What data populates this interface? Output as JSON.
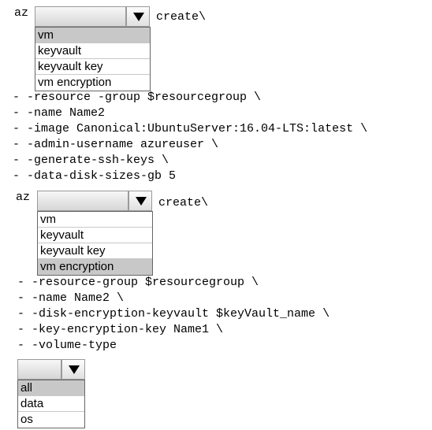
{
  "block1": {
    "prefix": "az",
    "suffix": "create\\",
    "options": [
      "vm",
      "keyvault",
      "keyvault key",
      "vm encryption"
    ],
    "selected_index": 0,
    "params": [
      "- -resource -group $resourcegroup \\",
      "- -name Name2",
      "- -image Canonical:UbuntuServer:16.04-LTS:latest \\",
      "- -admin-username azureuser \\",
      "- -generate-ssh-keys \\",
      "- -data-disk-sizes-gb 5"
    ]
  },
  "block2": {
    "prefix": "az",
    "suffix": "create\\",
    "options": [
      "vm",
      "keyvault",
      "keyvault key",
      "vm encryption"
    ],
    "selected_index": 3,
    "params": [
      "- -resource-group $resourcegroup \\",
      "- -name Name2 \\",
      "- -disk-encryption-keyvault $keyVault_name \\",
      "- -key-encryption-key Name1 \\",
      "- -volume-type"
    ]
  },
  "block3": {
    "options": [
      "all",
      "data",
      "os"
    ],
    "selected_index": 0
  },
  "icons": {
    "dropdown_arrow": "triangle-down-icon"
  },
  "colors": {
    "selected_bg": "#c8c8c8",
    "border": "#666666"
  }
}
